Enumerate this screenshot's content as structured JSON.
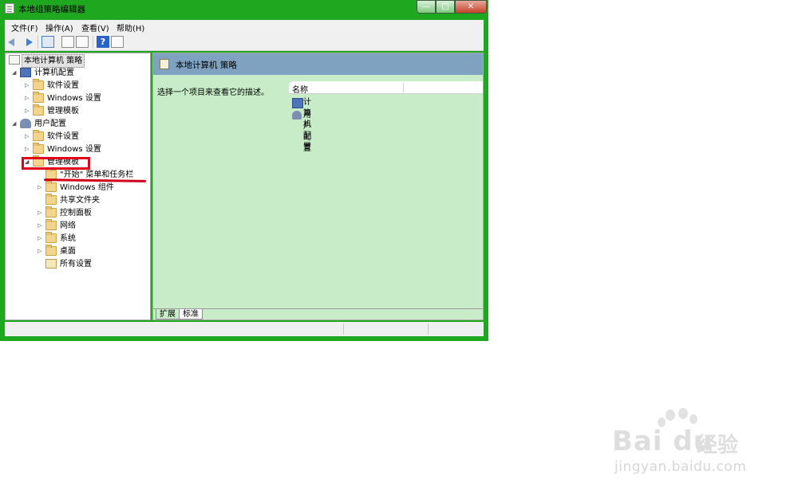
{
  "window": {
    "title": "本地组策略编辑器",
    "buttons": {
      "minimize": "—",
      "maximize": "□",
      "close": "✕"
    }
  },
  "menu": [
    {
      "label": "文件(F)"
    },
    {
      "label": "操作(A)"
    },
    {
      "label": "查看(V)"
    },
    {
      "label": "帮助(H)"
    }
  ],
  "toolbar": {
    "icons": [
      "back-arrow-icon",
      "forward-arrow-icon",
      "show-hide-tree-icon",
      "properties-icon",
      "export-list-icon",
      "help-icon",
      "show-hide-action-pane-icon"
    ],
    "help_glyph": "?"
  },
  "tree": {
    "root": "本地计算机 策略",
    "computer_config": {
      "label": "计算机配置",
      "children": [
        "软件设置",
        "Windows 设置",
        "管理模板"
      ]
    },
    "user_config": {
      "label": "用户配置",
      "children": [
        "软件设置",
        "Windows 设置",
        "管理模板"
      ]
    },
    "admin_templates_children": [
      "\"开始\" 菜单和任务栏",
      "Windows 组件",
      "共享文件夹",
      "控制面板",
      "网络",
      "系统",
      "桌面",
      "所有设置"
    ]
  },
  "right_pane": {
    "title": "本地计算机 策略",
    "description": "选择一个项目来查看它的描述。",
    "column_name": "名称",
    "items": [
      "计算机配置",
      "用户配置"
    ],
    "tabs": [
      "扩展",
      "标准"
    ]
  },
  "watermark": {
    "brand": "Bai du",
    "brand_cn": "经验",
    "url": "jingyan.baidu.com"
  },
  "colors": {
    "window_frame": "#1fa81f",
    "pane_background": "#c8ebc8",
    "header_blue": "#7ea2bf",
    "annotation_red": "#e0001a"
  }
}
